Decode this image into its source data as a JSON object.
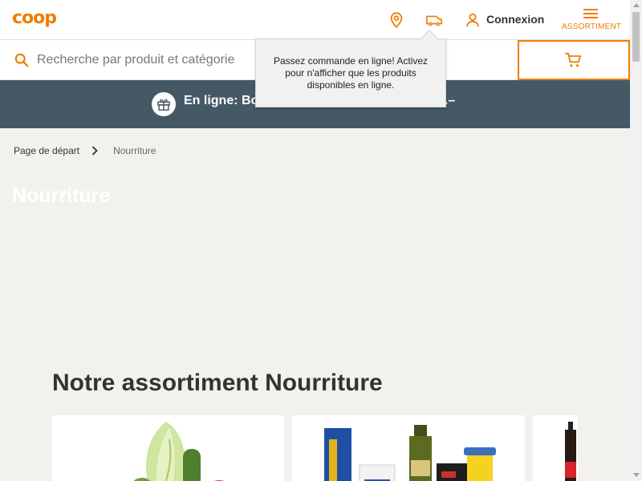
{
  "header": {
    "logo": "coop",
    "login_label": "Connexion",
    "menu_label": "ASSORTIMENT"
  },
  "search": {
    "placeholder": "Recherche par produit et catégorie"
  },
  "tooltip": {
    "text": "Passez commande en ligne! Activez pour n'afficher que les produits disponibles en ligne."
  },
  "promo": {
    "text": "En ligne: Bo",
    "text_end": "0.–"
  },
  "breadcrumb": {
    "home": "Page de départ",
    "current": "Nourriture"
  },
  "page_title": "Nourriture",
  "section_title": "Notre assortiment Nourriture",
  "colors": {
    "brand": "#f07d00",
    "banner": "#455866",
    "background": "#f3f1ee"
  },
  "icons": [
    "location-pin-icon",
    "delivery-van-icon",
    "user-icon",
    "menu-icon",
    "search-icon",
    "cart-icon",
    "gift-icon",
    "chevron-right-icon"
  ]
}
